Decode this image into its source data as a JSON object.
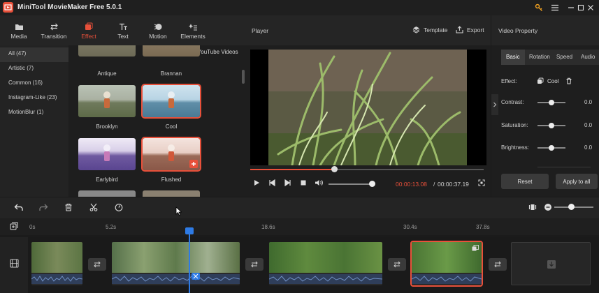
{
  "app": {
    "title": "MiniTool MovieMaker Free 5.0.1"
  },
  "toolbar": {
    "items": [
      {
        "label": "Media",
        "icon": "folder-icon"
      },
      {
        "label": "Transition",
        "icon": "swap-icon"
      },
      {
        "label": "Effect",
        "icon": "effect-icon"
      },
      {
        "label": "Text",
        "icon": "text-icon"
      },
      {
        "label": "Motion",
        "icon": "motion-icon"
      },
      {
        "label": "Elements",
        "icon": "elements-icon"
      }
    ],
    "active": "Effect"
  },
  "categories": [
    {
      "label": "All (47)"
    },
    {
      "label": "Artistic (7)"
    },
    {
      "label": "Common (16)"
    },
    {
      "label": "Instagram-Like (23)"
    },
    {
      "label": "MotionBlur (1)"
    }
  ],
  "effects_panel": {
    "youtube_link": "Download YouTube Videos",
    "effects": [
      {
        "label": "Antique"
      },
      {
        "label": "Brannan"
      },
      {
        "label": "Brooklyn"
      },
      {
        "label": "Cool"
      },
      {
        "label": "Earlybird"
      },
      {
        "label": "Flushed"
      }
    ]
  },
  "player": {
    "label": "Player",
    "template_label": "Template",
    "export_label": "Export",
    "current_time": "00:00:13.08",
    "separator": "/",
    "total_time": "00:00:37.19",
    "progress": 0.36,
    "volume": 0.9
  },
  "property": {
    "title": "Video Property",
    "tabs": [
      {
        "label": "Basic"
      },
      {
        "label": "Rotation"
      },
      {
        "label": "Speed"
      },
      {
        "label": "Audio"
      }
    ],
    "effect_label": "Effect:",
    "effect_value": "Cool",
    "rows": [
      {
        "label": "Contrast:",
        "value": "0.0"
      },
      {
        "label": "Saturation:",
        "value": "0.0"
      },
      {
        "label": "Brightness:",
        "value": "0.0"
      }
    ],
    "reset_label": "Reset",
    "apply_label": "Apply to all"
  },
  "timeline": {
    "ruler": [
      "0s",
      "5.2s",
      "18.6s",
      "30.4s",
      "37.8s"
    ]
  },
  "colors": {
    "accent": "#e8503a",
    "playhead": "#2e7be5"
  }
}
